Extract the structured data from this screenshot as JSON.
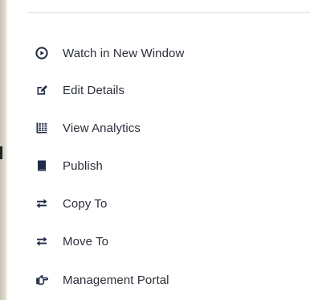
{
  "menu": {
    "items": [
      {
        "label": "Watch in New Window",
        "icon": "play-circle-icon"
      },
      {
        "label": "Edit Details",
        "icon": "edit-icon"
      },
      {
        "label": "View Analytics",
        "icon": "analytics-icon"
      },
      {
        "label": "Publish",
        "icon": "publish-icon"
      },
      {
        "label": "Copy To",
        "icon": "transfer-icon"
      },
      {
        "label": "Move To",
        "icon": "transfer-icon"
      },
      {
        "label": "Management Portal",
        "icon": "portal-icon"
      }
    ]
  },
  "colors": {
    "icon": "#1f2a44",
    "text": "#2b2f3a",
    "divider": "#e6e6e6"
  }
}
